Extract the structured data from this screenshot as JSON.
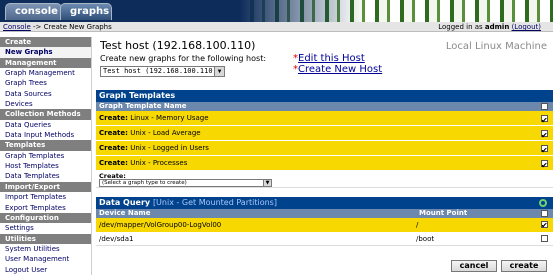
{
  "header": {
    "tabs": [
      {
        "label": "console"
      },
      {
        "label": "graphs"
      }
    ]
  },
  "breadcrumb": {
    "root": "Console",
    "separator": "->",
    "current": "Create New Graphs"
  },
  "login": {
    "prefix": "Logged in as",
    "user": "admin",
    "logout": "(Logout)"
  },
  "sidebar": {
    "items": [
      {
        "type": "header",
        "label": "Create"
      },
      {
        "type": "item",
        "label": "New Graphs",
        "active": true
      },
      {
        "type": "header",
        "label": "Management"
      },
      {
        "type": "item",
        "label": "Graph Management"
      },
      {
        "type": "item",
        "label": "Graph Trees"
      },
      {
        "type": "item",
        "label": "Data Sources"
      },
      {
        "type": "item",
        "label": "Devices"
      },
      {
        "type": "header",
        "label": "Collection Methods"
      },
      {
        "type": "item",
        "label": "Data Queries"
      },
      {
        "type": "item",
        "label": "Data Input Methods"
      },
      {
        "type": "header",
        "label": "Templates"
      },
      {
        "type": "item",
        "label": "Graph Templates"
      },
      {
        "type": "item",
        "label": "Host Templates"
      },
      {
        "type": "item",
        "label": "Data Templates"
      },
      {
        "type": "header",
        "label": "Import/Export"
      },
      {
        "type": "item",
        "label": "Import Templates"
      },
      {
        "type": "item",
        "label": "Export Templates"
      },
      {
        "type": "header",
        "label": "Configuration"
      },
      {
        "type": "item",
        "label": "Settings"
      },
      {
        "type": "header",
        "label": "Utilities"
      },
      {
        "type": "item",
        "label": "System Utilities"
      },
      {
        "type": "item",
        "label": "User Management"
      },
      {
        "type": "item",
        "label": "Logout User"
      }
    ]
  },
  "host": {
    "title": "Test host (192.168.100.110)",
    "subtitle": "Local Linux Machine",
    "create_label": "Create new graphs for the following host:",
    "selected_host": "Test host (192.168.100.110)",
    "edit_link": "Edit this Host",
    "create_host_link": "Create New Host"
  },
  "graph_templates": {
    "section_title": "Graph Templates",
    "column_header": "Graph Template Name",
    "rows": [
      {
        "prefix": "Create:",
        "name": "Linux - Memory Usage",
        "checked": true
      },
      {
        "prefix": "Create:",
        "name": "Unix - Load Average",
        "checked": true
      },
      {
        "prefix": "Create:",
        "name": "Unix - Logged in Users",
        "checked": true
      },
      {
        "prefix": "Create:",
        "name": "Unix - Processes",
        "checked": true
      }
    ],
    "create_label": "Create:",
    "create_select_placeholder": "(Select a graph type to create)"
  },
  "data_query": {
    "label": "Data Query",
    "query_name": "[Unix - Get Mounted Partitions]",
    "columns": [
      "Device Name",
      "Mount Point"
    ],
    "rows": [
      {
        "device": "/dev/mapper/VolGroup00-LogVol00",
        "mount": "/",
        "checked": true
      },
      {
        "device": "/dev/sda1",
        "mount": "/boot",
        "checked": false
      }
    ]
  },
  "buttons": {
    "cancel": "cancel",
    "create": "create"
  },
  "colors": {
    "header_blue": "#00438c",
    "highlight_yellow": "#f7d800",
    "topbar": "#0e2c5a"
  }
}
